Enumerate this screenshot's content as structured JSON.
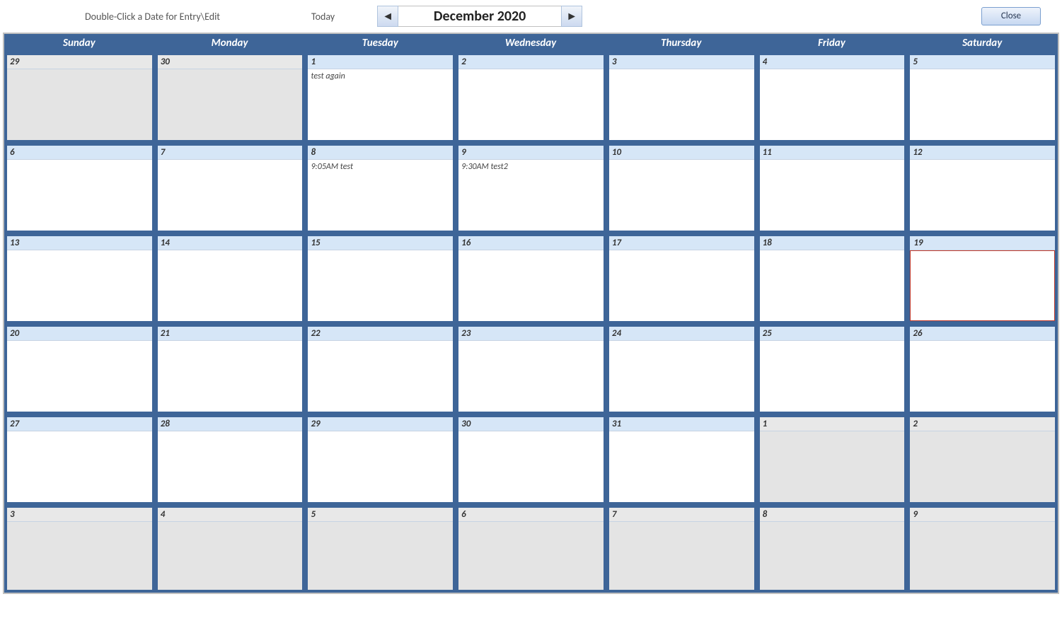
{
  "topbar": {
    "hint": "Double-Click a Date for Entry\\Edit",
    "today": "Today",
    "prev_glyph": "◄",
    "next_glyph": "►",
    "month_title": "December 2020",
    "close": "Close"
  },
  "days_of_week": [
    "Sunday",
    "Monday",
    "Tuesday",
    "Wednesday",
    "Thursday",
    "Friday",
    "Saturday"
  ],
  "weeks": [
    [
      {
        "num": "29",
        "other": true
      },
      {
        "num": "30",
        "other": true
      },
      {
        "num": "1",
        "entries": [
          "test again"
        ]
      },
      {
        "num": "2"
      },
      {
        "num": "3"
      },
      {
        "num": "4"
      },
      {
        "num": "5"
      }
    ],
    [
      {
        "num": "6"
      },
      {
        "num": "7"
      },
      {
        "num": "8",
        "entries": [
          "9:05AM test"
        ]
      },
      {
        "num": "9",
        "entries": [
          "9:30AM test2"
        ]
      },
      {
        "num": "10"
      },
      {
        "num": "11"
      },
      {
        "num": "12"
      }
    ],
    [
      {
        "num": "13"
      },
      {
        "num": "14"
      },
      {
        "num": "15"
      },
      {
        "num": "16"
      },
      {
        "num": "17"
      },
      {
        "num": "18"
      },
      {
        "num": "19",
        "today": true
      }
    ],
    [
      {
        "num": "20"
      },
      {
        "num": "21"
      },
      {
        "num": "22"
      },
      {
        "num": "23"
      },
      {
        "num": "24"
      },
      {
        "num": "25"
      },
      {
        "num": "26"
      }
    ],
    [
      {
        "num": "27"
      },
      {
        "num": "28"
      },
      {
        "num": "29"
      },
      {
        "num": "30"
      },
      {
        "num": "31"
      },
      {
        "num": "1",
        "other": true
      },
      {
        "num": "2",
        "other": true
      }
    ],
    [
      {
        "num": "3",
        "other": true
      },
      {
        "num": "4",
        "other": true
      },
      {
        "num": "5",
        "other": true
      },
      {
        "num": "6",
        "other": true
      },
      {
        "num": "7",
        "other": true
      },
      {
        "num": "8",
        "other": true
      },
      {
        "num": "9",
        "other": true
      }
    ]
  ]
}
